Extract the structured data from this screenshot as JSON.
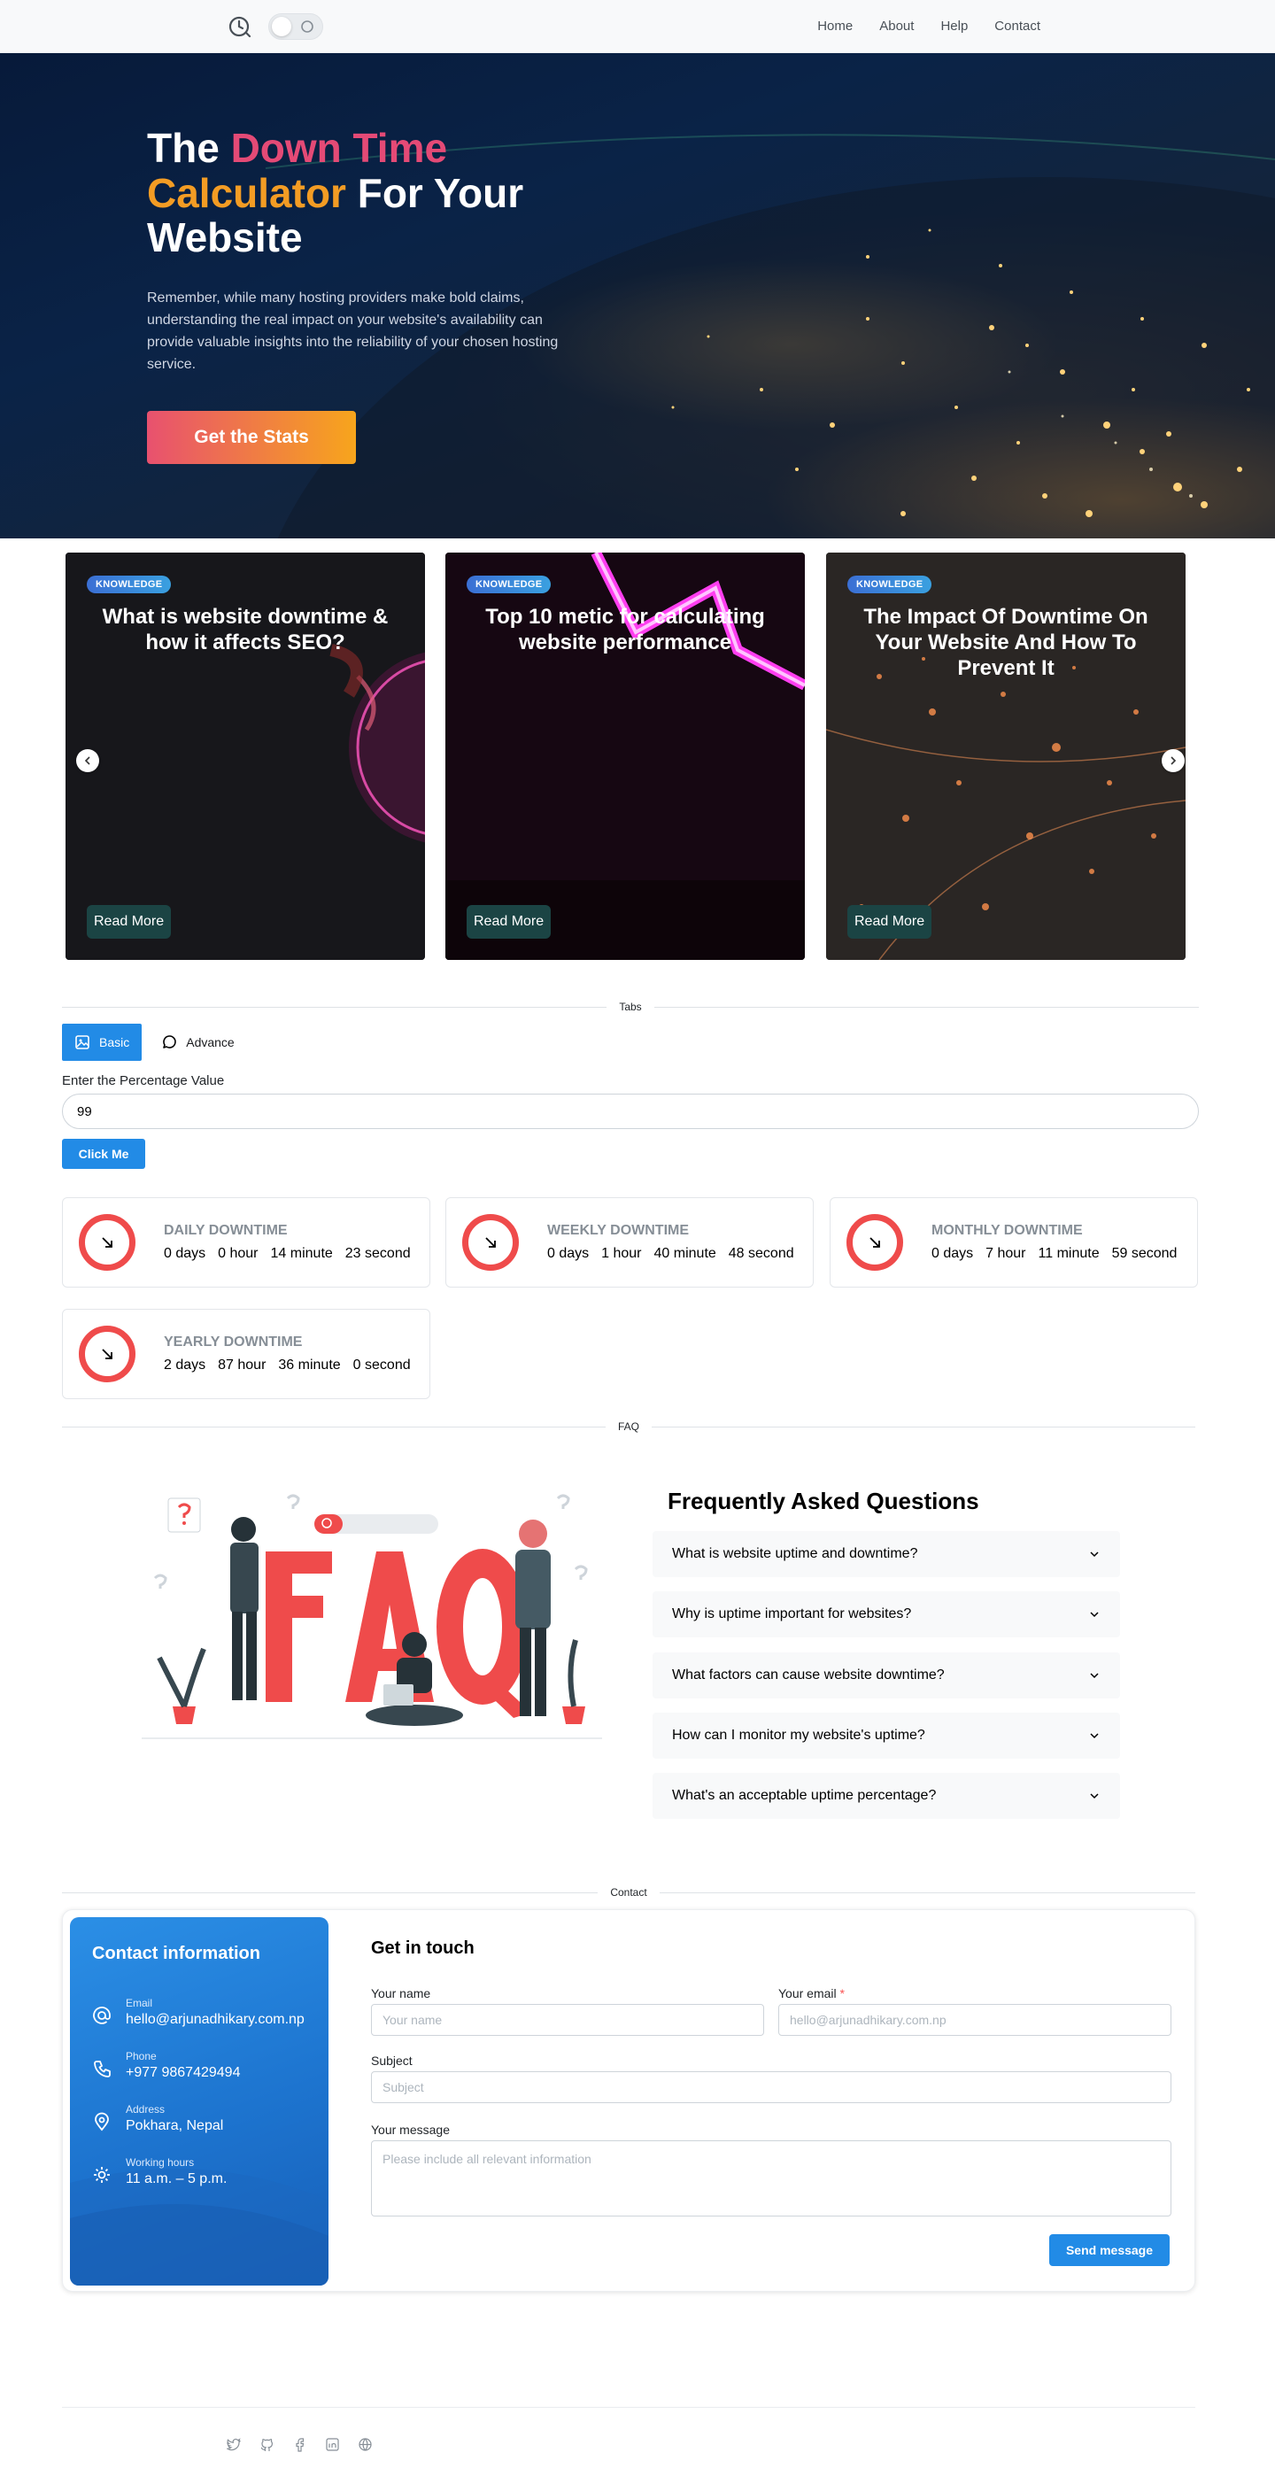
{
  "nav": {
    "items": [
      "Home",
      "About",
      "Help",
      "Contact"
    ]
  },
  "hero": {
    "title_part1": "The ",
    "title_highlight1": "Down Time",
    "title_highlight2": "Calculator",
    "title_part2": " For Your Website",
    "description": "Remember, while many hosting providers make bold claims, understanding the real impact on your website's availability can provide valuable insights into the reliability of your chosen hosting service.",
    "cta": "Get the Stats"
  },
  "carousel": {
    "cards": [
      {
        "badge": "KNOWLEDGE",
        "title": "What is website downtime & how it affects SEO?",
        "button": "Read More"
      },
      {
        "badge": "KNOWLEDGE",
        "title": "Top 10 metic for calculating website performance",
        "button": "Read More"
      },
      {
        "badge": "KNOWLEDGE",
        "title": "The Impact Of Downtime On Your Website And How To Prevent It",
        "button": "Read More"
      }
    ]
  },
  "tabs": {
    "divider": "Tabs",
    "items": [
      "Basic",
      "Advance"
    ],
    "input_label": "Enter the Percentage Value",
    "input_value": "99",
    "button": "Click Me"
  },
  "stats": [
    {
      "label": "DAILY DOWNTIME",
      "days": "0 days",
      "hours": "0 hour",
      "minutes": "14 minute",
      "seconds": "23 second"
    },
    {
      "label": "WEEKLY DOWNTIME",
      "days": "0 days",
      "hours": "1 hour",
      "minutes": "40 minute",
      "seconds": "48 second"
    },
    {
      "label": "MONTHLY DOWNTIME",
      "days": "0 days",
      "hours": "7 hour",
      "minutes": "11 minute",
      "seconds": "59 second"
    },
    {
      "label": "YEARLY DOWNTIME",
      "days": "2 days",
      "hours": "87 hour",
      "minutes": "36 minute",
      "seconds": "0 second"
    }
  ],
  "faq": {
    "divider": "FAQ",
    "heading": "Frequently Asked Questions",
    "questions": [
      "What is website uptime and downtime?",
      "Why is uptime important for websites?",
      "What factors can cause website downtime?",
      "How can I monitor my website's uptime?",
      "What's an acceptable uptime percentage?"
    ],
    "illustration_text": "FAQ"
  },
  "contact": {
    "divider": "Contact",
    "info_title": "Contact information",
    "email_label": "Email",
    "email": "hello@arjunadhikary.com.np",
    "phone_label": "Phone",
    "phone": "+977 9867429494",
    "address_label": "Address",
    "address": "Pokhara, Nepal",
    "hours_label": "Working hours",
    "hours": "11 a.m. – 5 p.m.",
    "form_title": "Get in touch",
    "name_label": "Your name",
    "name_placeholder": "Your name",
    "email_field_label": "Your email",
    "email_required": "*",
    "email_placeholder": "hello@arjunadhikary.com.np",
    "subject_label": "Subject",
    "subject_placeholder": "Subject",
    "message_label": "Your message",
    "message_placeholder": "Please include all relevant information",
    "send": "Send message"
  },
  "colors": {
    "primary": "#228be6",
    "accent_pink": "#e44a76",
    "accent_orange": "#f39c24",
    "danger": "#ef4b4b"
  }
}
